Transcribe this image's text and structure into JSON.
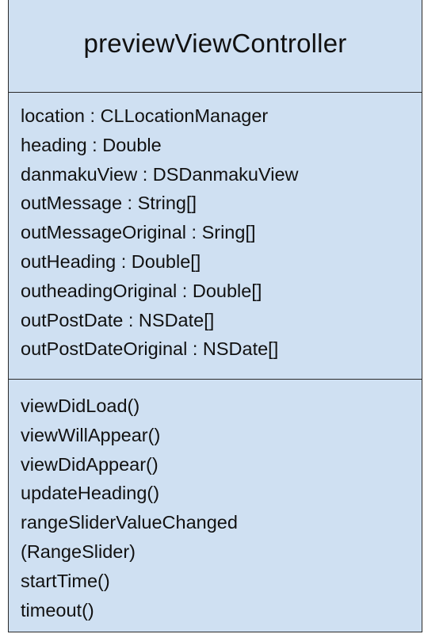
{
  "class_name": "previewViewController",
  "attributes": [
    "location : CLLocationManager",
    "heading : Double",
    "danmakuView : DSDanmakuView",
    "outMessage : String[]",
    "outMessageOriginal : Sring[]",
    "outHeading : Double[]",
    "outheadingOriginal : Double[]",
    "outPostDate : NSDate[]",
    "outPostDateOriginal : NSDate[]"
  ],
  "operations": [
    "viewDidLoad()",
    "viewWillAppear()",
    "viewDidAppear()",
    "updateHeading()",
    "rangeSliderValueChanged",
    "(RangeSlider)",
    "startTime()",
    "timeout()"
  ]
}
